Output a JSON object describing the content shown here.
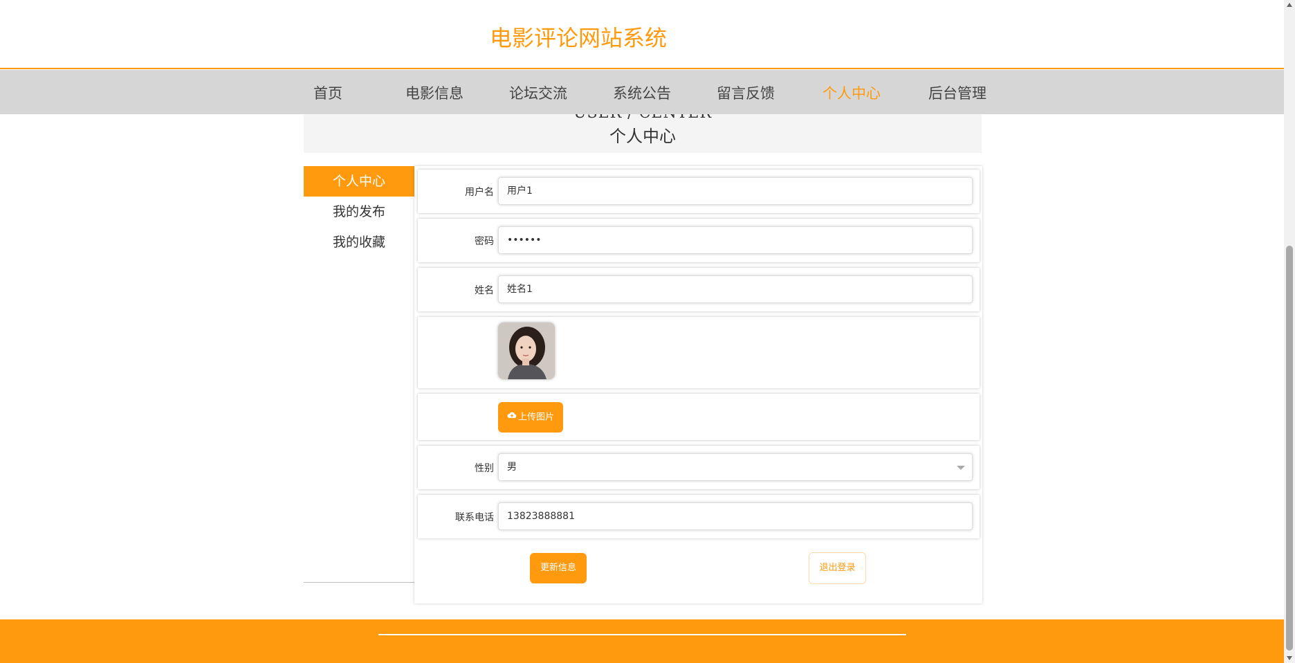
{
  "header": {
    "title": "电影评论网站系统"
  },
  "nav": {
    "items": [
      {
        "label": "首页"
      },
      {
        "label": "电影信息"
      },
      {
        "label": "论坛交流"
      },
      {
        "label": "系统公告"
      },
      {
        "label": "留言反馈"
      },
      {
        "label": "个人中心"
      },
      {
        "label": "后台管理"
      }
    ],
    "active": "个人中心"
  },
  "banner": {
    "subtitle_en": "USER / CENTER",
    "title": "个人中心"
  },
  "sidebar": {
    "items": [
      {
        "label": "个人中心"
      },
      {
        "label": "我的发布"
      },
      {
        "label": "我的收藏"
      }
    ]
  },
  "form": {
    "username": {
      "label": "用户名",
      "value": "用户1"
    },
    "password": {
      "label": "密码",
      "value": "••••••"
    },
    "name": {
      "label": "姓名",
      "value": "姓名1"
    },
    "upload_label": "上传图片",
    "gender": {
      "label": "性别",
      "value": "男"
    },
    "phone": {
      "label": "联系电话",
      "value": "13823888881"
    }
  },
  "actions": {
    "update": "更新信息",
    "logout": "退出登录"
  },
  "colors": {
    "accent": "#ff9a0e",
    "nav_bg": "#d6d6d6"
  }
}
